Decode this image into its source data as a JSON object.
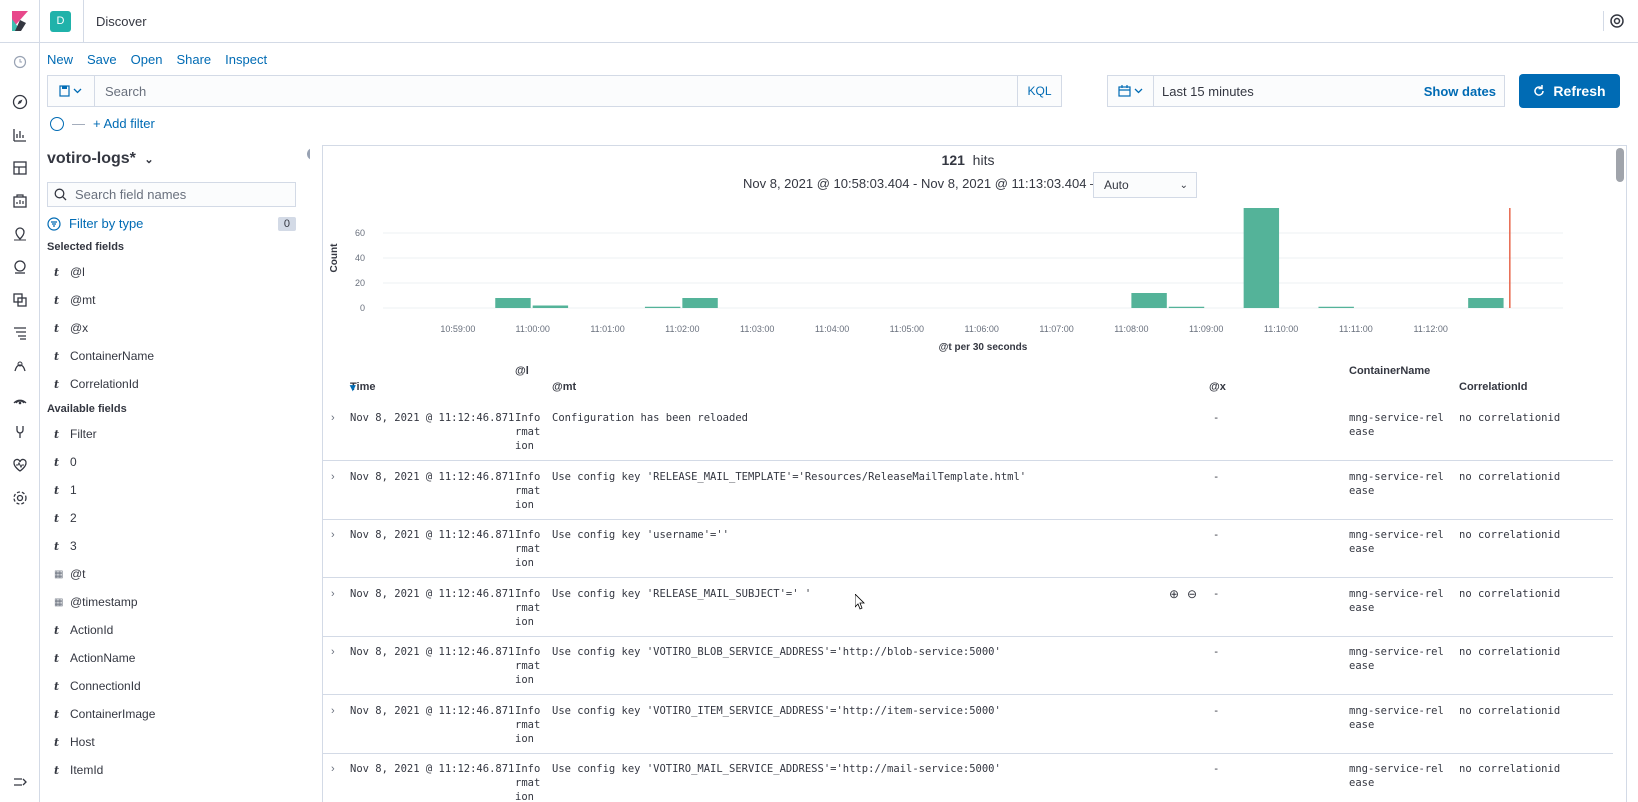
{
  "app": {
    "space_initial": "D",
    "title": "Discover"
  },
  "menu": [
    "New",
    "Save",
    "Open",
    "Share",
    "Inspect"
  ],
  "query": {
    "placeholder": "Search",
    "language": "KQL"
  },
  "timepicker": {
    "range": "Last 15 minutes",
    "show_dates": "Show dates"
  },
  "refresh_label": "Refresh",
  "add_filter": "+ Add filter",
  "sidebar": {
    "index_pattern": "votiro-logs*",
    "field_search_placeholder": "Search field names",
    "filter_by_type": "Filter by type",
    "filter_count": "0",
    "selected_title": "Selected fields",
    "selected_fields": [
      {
        "type": "t",
        "name": "@l"
      },
      {
        "type": "t",
        "name": "@mt"
      },
      {
        "type": "t",
        "name": "@x"
      },
      {
        "type": "t",
        "name": "ContainerName"
      },
      {
        "type": "t",
        "name": "CorrelationId"
      }
    ],
    "available_title": "Available fields",
    "available_fields": [
      {
        "type": "t",
        "name": "Filter"
      },
      {
        "type": "t",
        "name": "0"
      },
      {
        "type": "t",
        "name": "1"
      },
      {
        "type": "t",
        "name": "2"
      },
      {
        "type": "t",
        "name": "3"
      },
      {
        "type": "date",
        "name": "@t"
      },
      {
        "type": "date",
        "name": "@timestamp"
      },
      {
        "type": "t",
        "name": "ActionId"
      },
      {
        "type": "t",
        "name": "ActionName"
      },
      {
        "type": "t",
        "name": "ConnectionId"
      },
      {
        "type": "t",
        "name": "ContainerImage"
      },
      {
        "type": "t",
        "name": "Host"
      },
      {
        "type": "t",
        "name": "ItemId"
      }
    ]
  },
  "hits": {
    "count": "121",
    "label": "hits"
  },
  "time_range_text": "Nov 8, 2021 @ 10:58:03.404 - Nov 8, 2021 @ 11:13:03.404 —",
  "interval": "Auto",
  "chart_data": {
    "type": "bar",
    "ylabel": "Count",
    "xlabel": "@t per 30 seconds",
    "y_ticks": [
      0,
      20,
      40,
      60
    ],
    "ylim": [
      0,
      80
    ],
    "x_ticks": [
      "10:59:00",
      "11:00:00",
      "11:01:00",
      "11:02:00",
      "11:03:00",
      "11:04:00",
      "11:05:00",
      "11:06:00",
      "11:07:00",
      "11:08:00",
      "11:09:00",
      "11:10:00",
      "11:11:00",
      "11:12:00"
    ],
    "bars": [
      {
        "x": "10:59:30",
        "value": 8
      },
      {
        "x": "11:00:00",
        "value": 2
      },
      {
        "x": "11:01:30",
        "value": 1
      },
      {
        "x": "11:02:00",
        "value": 8
      },
      {
        "x": "11:08:00",
        "value": 12
      },
      {
        "x": "11:08:30",
        "value": 1
      },
      {
        "x": "11:09:30",
        "value": 80
      },
      {
        "x": "11:10:30",
        "value": 1
      },
      {
        "x": "11:12:30",
        "value": 8
      }
    ],
    "bar_color": "#54b399",
    "now_marker_color": "#e7664c"
  },
  "table": {
    "columns": [
      "Time",
      "@l",
      "@mt",
      "@x",
      "ContainerName",
      "CorrelationId"
    ],
    "rows": [
      {
        "time": "Nov 8, 2021 @ 11:12:46.871",
        "l": "Information",
        "mt": "Configuration has been reloaded",
        "x": "-",
        "cn": "mng-service-release",
        "cid": "no correlationid"
      },
      {
        "time": "Nov 8, 2021 @ 11:12:46.871",
        "l": "Information",
        "mt": "Use config key 'RELEASE_MAIL_TEMPLATE'='Resources/ReleaseMailTemplate.html'",
        "x": "-",
        "cn": "mng-service-release",
        "cid": "no correlationid"
      },
      {
        "time": "Nov 8, 2021 @ 11:12:46.871",
        "l": "Information",
        "mt": "Use config key 'username'=''",
        "x": "-",
        "cn": "mng-service-release",
        "cid": "no correlationid"
      },
      {
        "time": "Nov 8, 2021 @ 11:12:46.871",
        "l": "Information",
        "mt": "Use config key 'RELEASE_MAIL_SUBJECT'=' '",
        "x": "-",
        "cn": "mng-service-release",
        "cid": "no correlationid"
      },
      {
        "time": "Nov 8, 2021 @ 11:12:46.871",
        "l": "Information",
        "mt": "Use config key 'VOTIRO_BLOB_SERVICE_ADDRESS'='http://blob-service:5000'",
        "x": "-",
        "cn": "mng-service-release",
        "cid": "no correlationid"
      },
      {
        "time": "Nov 8, 2021 @ 11:12:46.871",
        "l": "Information",
        "mt": "Use config key 'VOTIRO_ITEM_SERVICE_ADDRESS'='http://item-service:5000'",
        "x": "-",
        "cn": "mng-service-release",
        "cid": "no correlationid"
      },
      {
        "time": "Nov 8, 2021 @ 11:12:46.871",
        "l": "Information",
        "mt": "Use config key 'VOTIRO_MAIL_SERVICE_ADDRESS'='http://mail-service:5000'",
        "x": "-",
        "cn": "mng-service-release",
        "cid": "no correlationid"
      }
    ]
  }
}
